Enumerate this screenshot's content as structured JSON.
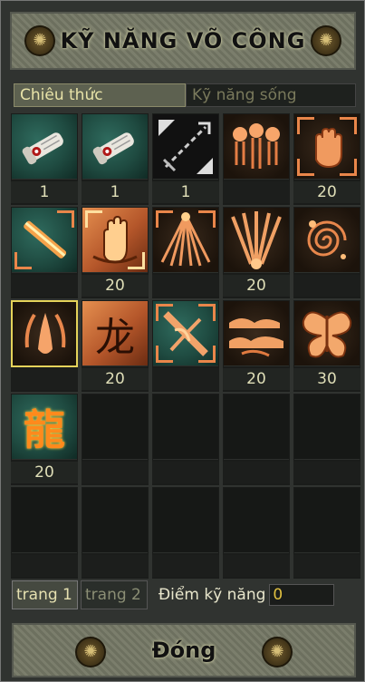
{
  "window": {
    "title": "KỸ NĂNG VÕ CÔNG"
  },
  "tabs": [
    {
      "label": "Chiêu thức",
      "active": true
    },
    {
      "label": "Kỹ năng sống",
      "active": false
    }
  ],
  "skills": [
    {
      "icon": "scroll-icon",
      "level": "1"
    },
    {
      "icon": "scroll-icon",
      "level": "1"
    },
    {
      "icon": "arrows-diagonal-icon",
      "level": "1"
    },
    {
      "icon": "triple-flame-icon",
      "level": ""
    },
    {
      "icon": "palm-icon",
      "level": "20"
    },
    {
      "icon": "staff-icon",
      "level": ""
    },
    {
      "icon": "golden-palm-icon",
      "level": "20"
    },
    {
      "icon": "rays-icon",
      "level": ""
    },
    {
      "icon": "claws-icon",
      "level": "20"
    },
    {
      "icon": "swirl-icon",
      "level": ""
    },
    {
      "icon": "talon-icon",
      "level": "",
      "selected": true
    },
    {
      "icon": "dragon-character-icon",
      "level": "20",
      "glyph": "龙"
    },
    {
      "icon": "bound-cross-icon",
      "level": ""
    },
    {
      "icon": "clouds-icon",
      "level": "20"
    },
    {
      "icon": "butterfly-icon",
      "level": "30"
    },
    {
      "icon": "dragon-calligraphy-icon",
      "level": "20",
      "glyph": "龍"
    }
  ],
  "pages": [
    {
      "label": "trang 1",
      "active": true
    },
    {
      "label": "trang 2",
      "active": false
    }
  ],
  "skill_points": {
    "label": "Điểm kỹ năng",
    "value": "0"
  },
  "close_button": {
    "label": "Đóng"
  },
  "colors": {
    "selection": "#e5d35a",
    "accent": "#e9864a"
  }
}
